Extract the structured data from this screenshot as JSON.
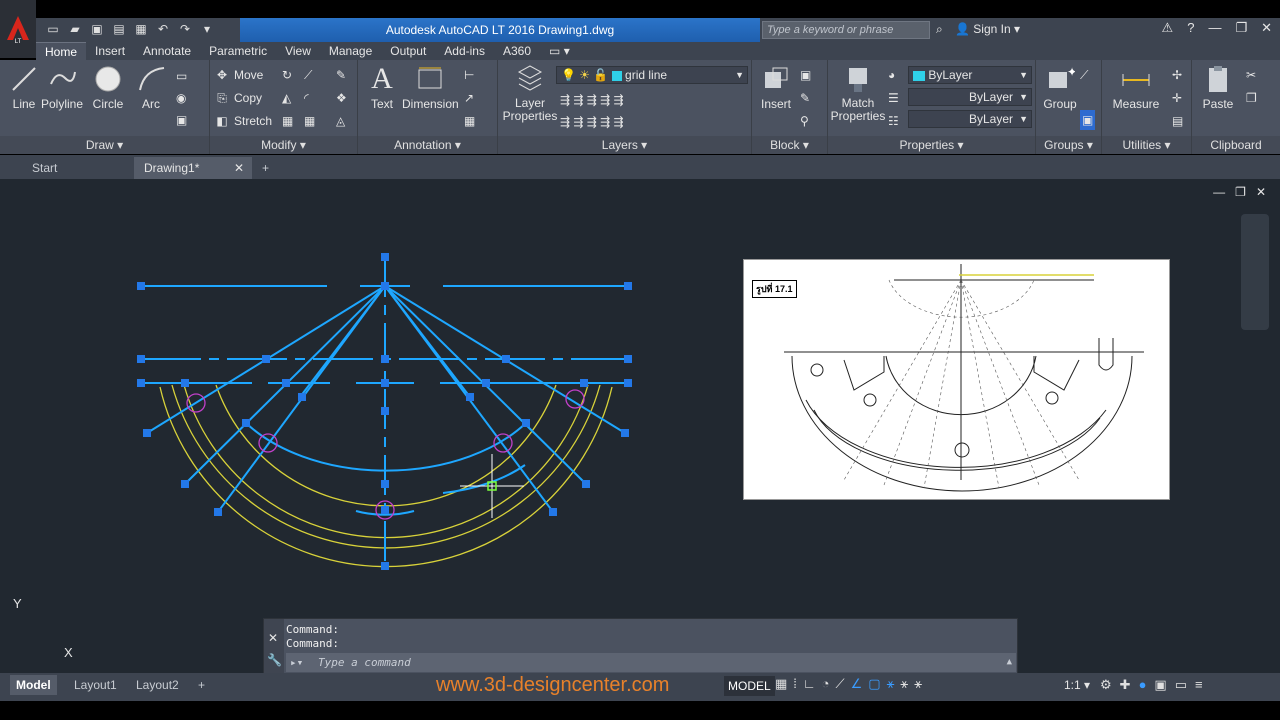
{
  "title": {
    "app_title": "Autodesk AutoCAD LT 2016    Drawing1.dwg",
    "search_placeholder": "Type a keyword or phrase",
    "sign_in": "Sign In"
  },
  "ribbon_tabs": [
    "Home",
    "Insert",
    "Annotate",
    "Parametric",
    "View",
    "Manage",
    "Output",
    "Add-ins",
    "A360"
  ],
  "ribbon": {
    "draw": {
      "title": "Draw",
      "line": "Line",
      "polyline": "Polyline",
      "circle": "Circle",
      "arc": "Arc"
    },
    "modify": {
      "title": "Modify",
      "move": "Move",
      "copy": "Copy",
      "stretch": "Stretch"
    },
    "annotation": {
      "title": "Annotation",
      "text": "Text",
      "dimension": "Dimension"
    },
    "layers": {
      "title": "Layers",
      "layer_properties": "Layer Properties",
      "current_layer": "grid line"
    },
    "block": {
      "title": "Block",
      "insert": "Insert"
    },
    "properties": {
      "title": "Properties",
      "match": "Match Properties",
      "color": "ByLayer",
      "linetype": "ByLayer",
      "lineweight": "ByLayer"
    },
    "groups": {
      "title": "Groups",
      "group": "Group"
    },
    "utilities": {
      "title": "Utilities",
      "measure": "Measure"
    },
    "clipboard": {
      "title": "Clipboard",
      "paste": "Paste"
    }
  },
  "file_tabs": {
    "start": "Start",
    "drawing": "Drawing1*"
  },
  "reference_image": {
    "label": "รูปที่ 17.1"
  },
  "command": {
    "line1": "Command:",
    "line2": "Command:",
    "placeholder": "Type a command"
  },
  "layout_tabs": {
    "model": "Model",
    "layout1": "Layout1",
    "layout2": "Layout2"
  },
  "status": {
    "watermark": "www.3d-designcenter.com",
    "model": "MODEL",
    "scale": "1:1"
  },
  "ucs": {
    "x": "X",
    "y": "Y"
  },
  "colors": {
    "accent": "#2b74c9",
    "geometry_blue": "#1ea7ff",
    "geometry_yellow": "#d8d23a",
    "grip": "#1e5fe0",
    "canvas": "#212830"
  }
}
